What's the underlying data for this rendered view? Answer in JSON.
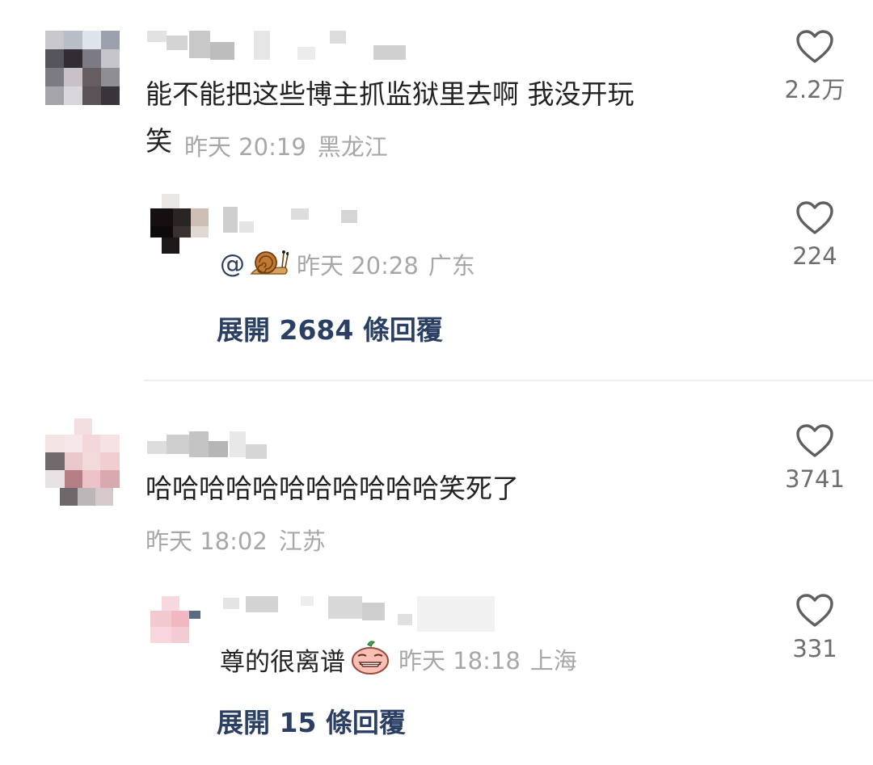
{
  "comments": [
    {
      "text": "能不能把这些博主抓监狱里去啊 我没开玩笑",
      "text_line1": "能不能把这些博主抓监狱里去啊 我没开玩",
      "text_line2": "笑",
      "time": "昨天 20:19",
      "location": "黑龙江",
      "likes": "2.2万",
      "reply": {
        "mention": "@",
        "emoji": "snail-emoji",
        "time": "昨天 20:28",
        "location": "广东",
        "likes": "224"
      },
      "expand_label": "展開 2684 條回覆"
    },
    {
      "text": "哈哈哈哈哈哈哈哈哈哈哈笑死了",
      "time": "昨天 18:02",
      "location": "江苏",
      "likes": "3741",
      "reply": {
        "text": "尊的很离谱",
        "emoji": "sad-face-emoji",
        "time": "昨天 18:18",
        "location": "上海",
        "likes": "331"
      },
      "expand_label": "展開 15 條回覆"
    }
  ],
  "colors": {
    "text": "#222222",
    "meta": "#a7a7a7",
    "like_count": "#6e6e6e",
    "expand_link": "#2b3f63",
    "divider": "#eeeeee"
  }
}
